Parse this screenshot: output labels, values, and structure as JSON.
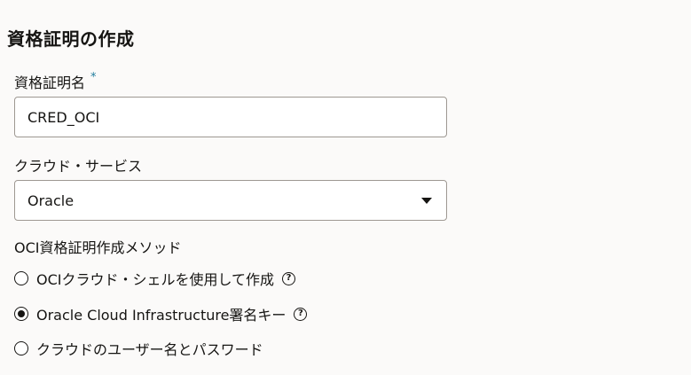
{
  "form": {
    "title": "資格証明の作成",
    "credential_name": {
      "label": "資格証明名",
      "required_marker": "*",
      "value": "CRED_OCI"
    },
    "cloud_service": {
      "label": "クラウド・サービス",
      "selected": "Oracle"
    },
    "method": {
      "label": "OCI資格証明作成メソッド",
      "options": [
        {
          "label": "OCIクラウド・シェルを使用して作成",
          "selected": false,
          "has_help": true
        },
        {
          "label": "Oracle Cloud Infrastructure署名キー",
          "selected": true,
          "has_help": true
        },
        {
          "label": "クラウドのユーザー名とパスワード",
          "selected": false,
          "has_help": false
        }
      ]
    },
    "icons": {
      "help": "help-circle-icon",
      "dropdown": "chevron-down-icon"
    },
    "help_glyph": "?"
  }
}
